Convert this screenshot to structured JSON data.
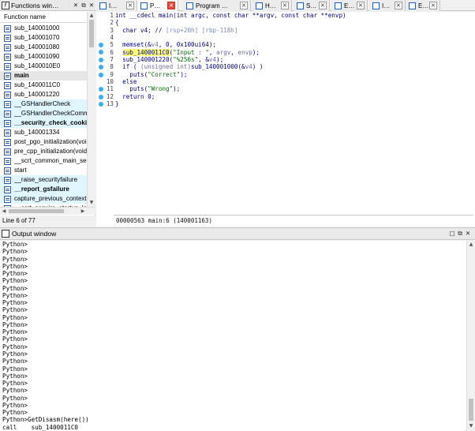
{
  "functions_window": {
    "title": "Functions win…",
    "column_header": "Function name",
    "items": [
      {
        "name": "sub_140001000",
        "bold": false,
        "style": "plain"
      },
      {
        "name": "sub_140001070",
        "bold": false,
        "style": "plain"
      },
      {
        "name": "sub_140001080",
        "bold": false,
        "style": "plain"
      },
      {
        "name": "sub_140001090",
        "bold": false,
        "style": "plain"
      },
      {
        "name": "sub_1400010E0",
        "bold": false,
        "style": "plain"
      },
      {
        "name": "main",
        "bold": true,
        "style": "selected"
      },
      {
        "name": "sub_1400011C0",
        "bold": false,
        "style": "plain"
      },
      {
        "name": "sub_140001220",
        "bold": false,
        "style": "plain"
      },
      {
        "name": "__GSHandlerCheck",
        "bold": false,
        "style": "alt"
      },
      {
        "name": "__GSHandlerCheckCommo",
        "bold": false,
        "style": "alt"
      },
      {
        "name": "__security_check_cookie",
        "bold": true,
        "style": "alt"
      },
      {
        "name": "sub_140001334",
        "bold": false,
        "style": "plain"
      },
      {
        "name": "post_pgo_initialization(void",
        "bold": false,
        "style": "plain"
      },
      {
        "name": "pre_cpp_initialization(void)",
        "bold": false,
        "style": "plain"
      },
      {
        "name": "__scrt_common_main_seh(",
        "bold": false,
        "style": "plain"
      },
      {
        "name": "start",
        "bold": false,
        "style": "plain"
      },
      {
        "name": "__raise_securityfailure",
        "bold": false,
        "style": "alt"
      },
      {
        "name": "__report_gsfailure",
        "bold": true,
        "style": "alt"
      },
      {
        "name": "capture_previous_context",
        "bold": false,
        "style": "alt"
      },
      {
        "name": "__scrt_acquire_startup_lock",
        "bold": false,
        "style": "plain"
      }
    ],
    "status": "Line 6 of 77"
  },
  "tabs": [
    {
      "label": "I…",
      "close": "plain",
      "active": false
    },
    {
      "label": "P…",
      "close": "red",
      "active": true
    },
    {
      "label": "Program …",
      "close": "plain",
      "active": false
    },
    {
      "label": "H…",
      "close": "plain",
      "active": false
    },
    {
      "label": "S…",
      "close": "plain",
      "active": false
    },
    {
      "label": "E…",
      "close": "plain",
      "active": false
    },
    {
      "label": "I…",
      "close": "plain",
      "active": false
    },
    {
      "label": "E…",
      "close": "plain",
      "active": false
    }
  ],
  "pseudocode": {
    "lines": [
      {
        "n": "1",
        "dot": false,
        "parts": [
          {
            "t": "int __cdecl main(int argc, const char **argv, const char **envp)",
            "c": "code"
          }
        ]
      },
      {
        "n": "2",
        "dot": false,
        "parts": [
          {
            "t": "{",
            "c": "code"
          }
        ]
      },
      {
        "n": "3",
        "dot": false,
        "parts": [
          {
            "t": "  char v4; // ",
            "c": "code"
          },
          {
            "t": "[rsp+20h] [rbp-118h]",
            "c": "comment"
          }
        ]
      },
      {
        "n": "4",
        "dot": false,
        "parts": []
      },
      {
        "n": "5",
        "dot": true,
        "parts": [
          {
            "t": "  memset(&",
            "c": "code"
          },
          {
            "t": "v4",
            "c": "var"
          },
          {
            "t": ", 0, 0x100ui64);",
            "c": "code"
          }
        ]
      },
      {
        "n": "6",
        "dot": true,
        "parts": [
          {
            "t": "  ",
            "c": "code"
          },
          {
            "t": "sub_1400011C0",
            "c": "hl"
          },
          {
            "t": "(",
            "c": "code"
          },
          {
            "t": "\"Input : \"",
            "c": "str"
          },
          {
            "t": ", ",
            "c": "code"
          },
          {
            "t": "argv",
            "c": "var"
          },
          {
            "t": ", ",
            "c": "code"
          },
          {
            "t": "envp",
            "c": "var"
          },
          {
            "t": ");",
            "c": "code"
          }
        ]
      },
      {
        "n": "7",
        "dot": true,
        "parts": [
          {
            "t": "  sub_140001220(",
            "c": "code"
          },
          {
            "t": "\"%256s\"",
            "c": "str"
          },
          {
            "t": ", &",
            "c": "code"
          },
          {
            "t": "v4",
            "c": "var"
          },
          {
            "t": ");",
            "c": "code"
          }
        ]
      },
      {
        "n": "8",
        "dot": true,
        "parts": [
          {
            "t": "  if ( ",
            "c": "code"
          },
          {
            "t": "(unsigned int)",
            "c": "var"
          },
          {
            "t": "sub_140001000(&",
            "c": "code"
          },
          {
            "t": "v4",
            "c": "var"
          },
          {
            "t": ") )",
            "c": "code"
          }
        ]
      },
      {
        "n": "9",
        "dot": true,
        "parts": [
          {
            "t": "    puts(",
            "c": "code"
          },
          {
            "t": "\"Correct\"",
            "c": "str"
          },
          {
            "t": ");",
            "c": "code"
          }
        ]
      },
      {
        "n": "10",
        "dot": false,
        "parts": [
          {
            "t": "  else",
            "c": "code"
          }
        ]
      },
      {
        "n": "11",
        "dot": true,
        "parts": [
          {
            "t": "    puts(",
            "c": "code"
          },
          {
            "t": "\"Wrong\"",
            "c": "str"
          },
          {
            "t": ");",
            "c": "code"
          }
        ]
      },
      {
        "n": "12",
        "dot": true,
        "parts": [
          {
            "t": "  return 0;",
            "c": "code"
          }
        ]
      },
      {
        "n": "13",
        "dot": true,
        "parts": [
          {
            "t": "}",
            "c": "code"
          }
        ]
      }
    ],
    "status": "00000563 main:6 (140001163)"
  },
  "output_window": {
    "title": "Output window",
    "lines": [
      "Python>",
      "Python>",
      "Python>",
      "Python>",
      "Python>",
      "Python>",
      "Python>",
      "Python>",
      "Python>",
      "Python>",
      "Python>",
      "Python>",
      "Python>",
      "Python>",
      "Python>",
      "Python>",
      "Python>",
      "Python>",
      "Python>",
      "Python>",
      "Python>",
      "Python>",
      "Python>",
      "Python>",
      "Python>GetDisasm(here())",
      "call    sub_1400011C0"
    ]
  },
  "colors": {
    "alt_row": "#dff6ff",
    "highlight": "#ffff80",
    "breakpoint_dot": "#3aaef0",
    "code_text": "#000080",
    "string_text": "#0a6b0a",
    "close_red": "#e5473a"
  }
}
